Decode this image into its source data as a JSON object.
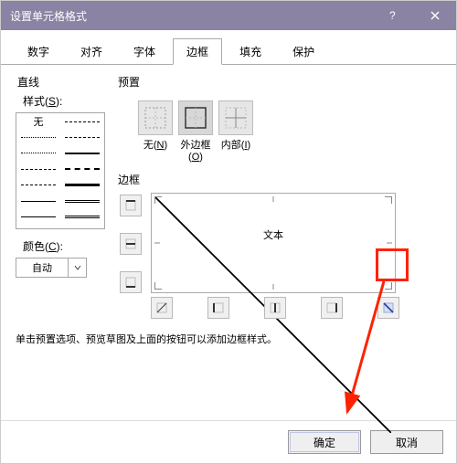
{
  "titlebar": {
    "title": "设置单元格格式"
  },
  "tabs": {
    "number": "数字",
    "align": "对齐",
    "font": "字体",
    "border": "边框",
    "fill": "填充",
    "protect": "保护"
  },
  "left": {
    "lineHeading": "直线",
    "styleLabelPrefix": "样式(",
    "styleHotkey": "S",
    "styleLabelSuffix": "):",
    "noneLabel": "无",
    "colorLabelPrefix": "颜色(",
    "colorHotkey": "C",
    "colorLabelSuffix": "):",
    "colorValue": "自动"
  },
  "presets": {
    "heading": "预置",
    "none": {
      "pre": "无(",
      "key": "N",
      "post": ")"
    },
    "outer": {
      "pre": "外边框(",
      "key": "O",
      "post": ")"
    },
    "inner": {
      "pre": "内部(",
      "key": "I",
      "post": ")"
    }
  },
  "borderSection": {
    "heading": "边框",
    "previewText": "文本"
  },
  "hint": "单击预置选项、预览草图及上面的按钮可以添加边框样式。",
  "buttons": {
    "ok": "确定",
    "cancel": "取消"
  }
}
